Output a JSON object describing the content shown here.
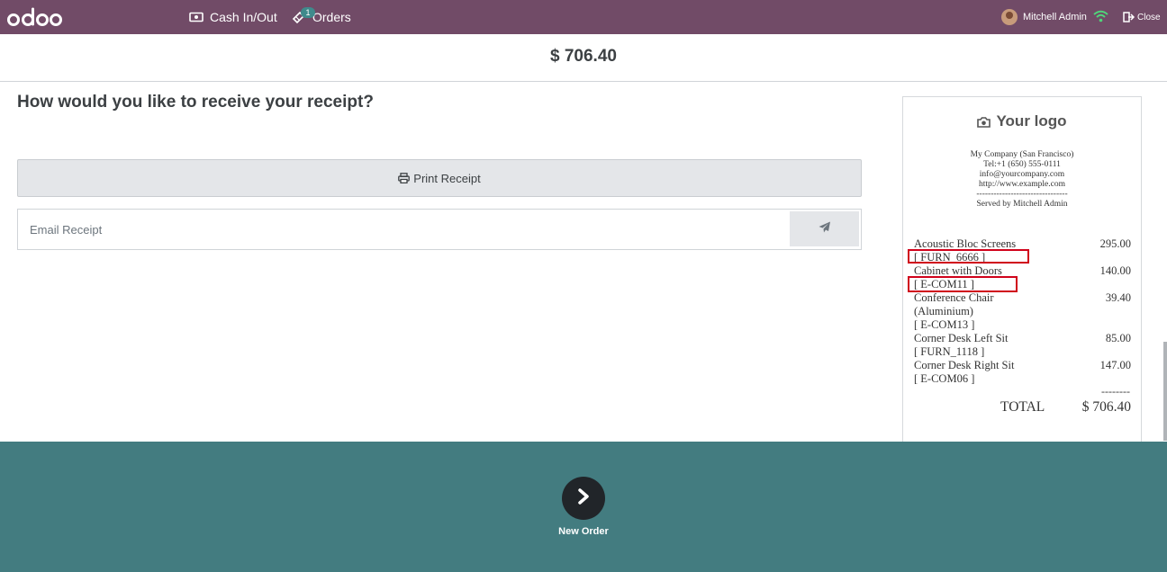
{
  "app": {
    "logo_text": "odoo",
    "brand_color": "#714b67",
    "footer_color": "#437c80"
  },
  "topbar": {
    "cash_label": "Cash In/Out",
    "cash_icon": "money-icon",
    "orders_label": "Orders",
    "orders_icon": "ticket-icon",
    "orders_count": "1",
    "user_name": "Mitchell Admin",
    "wifi_icon": "wifi-icon",
    "close_label": "Close",
    "close_icon": "sign-out-icon"
  },
  "payment": {
    "total": "$ 706.40"
  },
  "receipt_options": {
    "question": "How would you like to receive your receipt?",
    "print_label": "Print Receipt",
    "print_icon": "print-icon",
    "email_placeholder": "Email Receipt",
    "send_icon": "paper-plane-icon"
  },
  "receipt": {
    "logo_text": "Your logo",
    "logo_icon": "camera-icon",
    "company_lines": [
      "My Company (San Francisco)",
      "Tel:+1 (650) 555-0111",
      "info@yourcompany.com",
      "http://www.example.com",
      "--------------------------------",
      "Served by Mitchell Admin"
    ],
    "lines": [
      {
        "name": "Acoustic Bloc Screens",
        "code": "[ FURN_6666 ]",
        "price": "295.00",
        "highlighted": true
      },
      {
        "name": "Cabinet with Doors",
        "code": "[ E-COM11 ]",
        "price": "140.00",
        "highlighted": true
      },
      {
        "name": "Conference Chair (Aluminium)",
        "code": "[ E-COM13 ]",
        "price": "39.40",
        "highlighted": false
      },
      {
        "name": "Corner Desk Left Sit",
        "code": "[ FURN_1118 ]",
        "price": "85.00",
        "highlighted": false
      },
      {
        "name": "Corner Desk Right Sit",
        "code": "[ E-COM06 ]",
        "price": "147.00",
        "highlighted": false
      }
    ],
    "dashes": "--------",
    "total_label": "TOTAL",
    "total_value": "$ 706.40"
  },
  "footer": {
    "new_order_label": "New Order",
    "new_order_icon": "chevron-right-icon"
  }
}
